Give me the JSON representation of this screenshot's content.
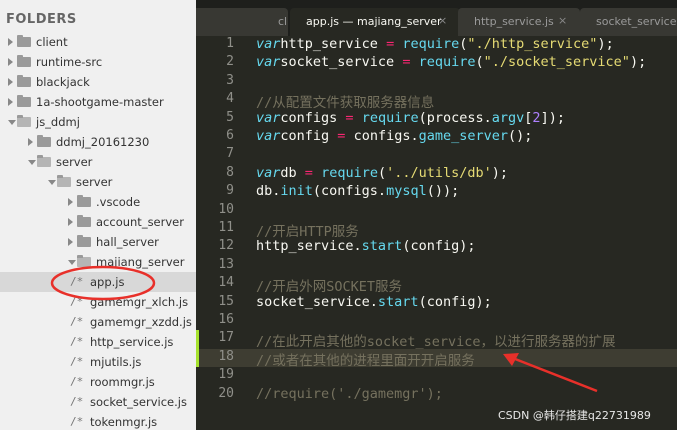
{
  "sidebar": {
    "header": "FOLDERS",
    "items": [
      {
        "label": "client",
        "type": "folder",
        "depth": 0,
        "state": "collapsed"
      },
      {
        "label": "runtime-src",
        "type": "folder",
        "depth": 0,
        "state": "collapsed"
      },
      {
        "label": "blackjack",
        "type": "folder",
        "depth": 0,
        "state": "collapsed"
      },
      {
        "label": "1a-shootgame-master",
        "type": "folder",
        "depth": 0,
        "state": "collapsed"
      },
      {
        "label": "js_ddmj",
        "type": "folder",
        "depth": 0,
        "state": "expanded"
      },
      {
        "label": "ddmj_20161230",
        "type": "folder",
        "depth": 1,
        "state": "collapsed"
      },
      {
        "label": "server",
        "type": "folder",
        "depth": 1,
        "state": "expanded"
      },
      {
        "label": "server",
        "type": "folder",
        "depth": 2,
        "state": "expanded"
      },
      {
        "label": ".vscode",
        "type": "folder",
        "depth": 3,
        "state": "collapsed"
      },
      {
        "label": "account_server",
        "type": "folder",
        "depth": 3,
        "state": "collapsed"
      },
      {
        "label": "hall_server",
        "type": "folder",
        "depth": 3,
        "state": "collapsed"
      },
      {
        "label": "majiang_server",
        "type": "folder",
        "depth": 3,
        "state": "expanded"
      },
      {
        "label": "app.js",
        "type": "file",
        "depth": 4,
        "selected": true
      },
      {
        "label": "gamemgr_xlch.js",
        "type": "file",
        "depth": 4
      },
      {
        "label": "gamemgr_xzdd.js",
        "type": "file",
        "depth": 4
      },
      {
        "label": "http_service.js",
        "type": "file",
        "depth": 4
      },
      {
        "label": "mjutils.js",
        "type": "file",
        "depth": 4
      },
      {
        "label": "roommgr.js",
        "type": "file",
        "depth": 4
      },
      {
        "label": "socket_service.js",
        "type": "file",
        "depth": 4
      },
      {
        "label": "tokenmgr.js",
        "type": "file",
        "depth": 4
      }
    ]
  },
  "tabs": {
    "nav": "◀ ▶",
    "items": [
      {
        "label": "cl",
        "active": false
      },
      {
        "label": "app.js — majiang_server",
        "active": true
      },
      {
        "label": "http_service.js",
        "active": false
      },
      {
        "label": "socket_service.js",
        "active": false
      }
    ],
    "close_glyph": "×"
  },
  "editor": {
    "highlighted_line": 18,
    "modified_lines": [
      17,
      18
    ],
    "lines": [
      {
        "n": "1",
        "tokens": [
          [
            "kw",
            "var"
          ],
          [
            "",
            "http_service "
          ],
          [
            "op",
            "="
          ],
          [
            "",
            " "
          ],
          [
            "fn",
            "require"
          ],
          [
            "",
            "("
          ],
          [
            "str",
            "\"./http_service\""
          ],
          [
            "",
            ");"
          ]
        ]
      },
      {
        "n": "2",
        "tokens": [
          [
            "kw",
            "var"
          ],
          [
            "",
            "socket_service "
          ],
          [
            "op",
            "="
          ],
          [
            "",
            " "
          ],
          [
            "fn",
            "require"
          ],
          [
            "",
            "("
          ],
          [
            "str",
            "\"./socket_service\""
          ],
          [
            "",
            ");"
          ]
        ]
      },
      {
        "n": "3",
        "tokens": []
      },
      {
        "n": "4",
        "tokens": [
          [
            "comment",
            "//从配置文件获取服务器信息"
          ]
        ]
      },
      {
        "n": "5",
        "tokens": [
          [
            "kw",
            "var"
          ],
          [
            "",
            "configs "
          ],
          [
            "op",
            "="
          ],
          [
            "",
            " "
          ],
          [
            "fn",
            "require"
          ],
          [
            "",
            "(process."
          ],
          [
            "fn",
            "argv"
          ],
          [
            "",
            "["
          ],
          [
            "num",
            "2"
          ],
          [
            "",
            "]);"
          ]
        ]
      },
      {
        "n": "6",
        "tokens": [
          [
            "kw",
            "var"
          ],
          [
            "",
            "config "
          ],
          [
            "op",
            "="
          ],
          [
            "",
            " configs."
          ],
          [
            "fn",
            "game_server"
          ],
          [
            "",
            "();"
          ]
        ]
      },
      {
        "n": "7",
        "tokens": []
      },
      {
        "n": "8",
        "tokens": [
          [
            "kw",
            "var"
          ],
          [
            "",
            "db "
          ],
          [
            "op",
            "="
          ],
          [
            "",
            " "
          ],
          [
            "fn",
            "require"
          ],
          [
            "",
            "("
          ],
          [
            "str",
            "'../utils/db'"
          ],
          [
            "",
            ");"
          ]
        ]
      },
      {
        "n": "9",
        "tokens": [
          [
            "",
            "db."
          ],
          [
            "fn",
            "init"
          ],
          [
            "",
            "(configs."
          ],
          [
            "fn",
            "mysql"
          ],
          [
            "",
            "());"
          ]
        ]
      },
      {
        "n": "10",
        "tokens": []
      },
      {
        "n": "11",
        "tokens": [
          [
            "comment",
            "//开启HTTP服务"
          ]
        ]
      },
      {
        "n": "12",
        "tokens": [
          [
            "",
            "http_service."
          ],
          [
            "fn",
            "start"
          ],
          [
            "",
            "(config);"
          ]
        ]
      },
      {
        "n": "13",
        "tokens": []
      },
      {
        "n": "14",
        "tokens": [
          [
            "comment",
            "//开启外网SOCKET服务"
          ]
        ]
      },
      {
        "n": "15",
        "tokens": [
          [
            "",
            "socket_service."
          ],
          [
            "fn",
            "start"
          ],
          [
            "",
            "(config);"
          ]
        ]
      },
      {
        "n": "16",
        "tokens": []
      },
      {
        "n": "17",
        "tokens": [
          [
            "comment",
            "//在此开启其他的socket_service，以进行服务器的扩展"
          ]
        ]
      },
      {
        "n": "18",
        "tokens": [
          [
            "comment",
            "//或者在其他的进程里面开开启服务"
          ]
        ]
      },
      {
        "n": "19",
        "tokens": []
      },
      {
        "n": "20",
        "tokens": [
          [
            "comment",
            "//require('./gamemgr');"
          ]
        ]
      }
    ]
  },
  "watermark": "CSDN @韩仔搭建q22731989",
  "colors": {
    "background": "#272822",
    "keyword": "#66d9ef",
    "operator": "#f92672",
    "string": "#e6db74",
    "number": "#ae81ff",
    "comment": "#75715e",
    "annotation": "#e8302a"
  }
}
